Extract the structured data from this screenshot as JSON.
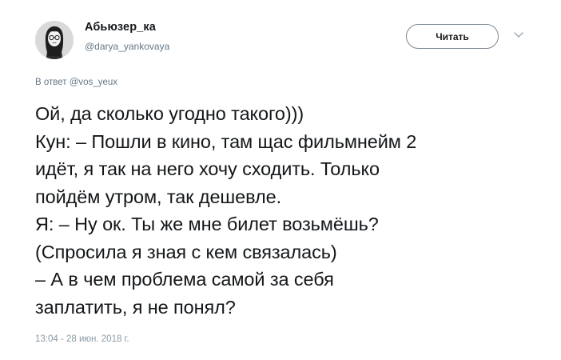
{
  "author": {
    "display_name": "Абьюзер_ка",
    "handle": "@darya_yankovaya",
    "avatar_icon": "avatar-girl-with-glasses-icon"
  },
  "actions": {
    "follow_label": "Читать",
    "more_icon": "chevron-down-icon"
  },
  "reply_context": {
    "prefix": "В ответ",
    "user": "@vos_yeux"
  },
  "tweet": {
    "lines": [
      "Ой, да сколько угодно такого)))",
      "Кун: – Пошли в кино, там щас фильмнейм 2",
      "идёт, я так на него хочу сходить. Только",
      "пойдём утром, так дешевле.",
      "Я: – Ну ок. Ты же мне билет возьмёшь?",
      "(Спросила я зная с кем связалась)",
      "– А в чем проблема самой за себя",
      "заплатить, я не понял?"
    ],
    "timestamp": "13:04 - 28 июн. 2018 г."
  },
  "colors": {
    "text_primary": "#14171a",
    "text_secondary": "#657786",
    "button_border": "#7b8791"
  }
}
